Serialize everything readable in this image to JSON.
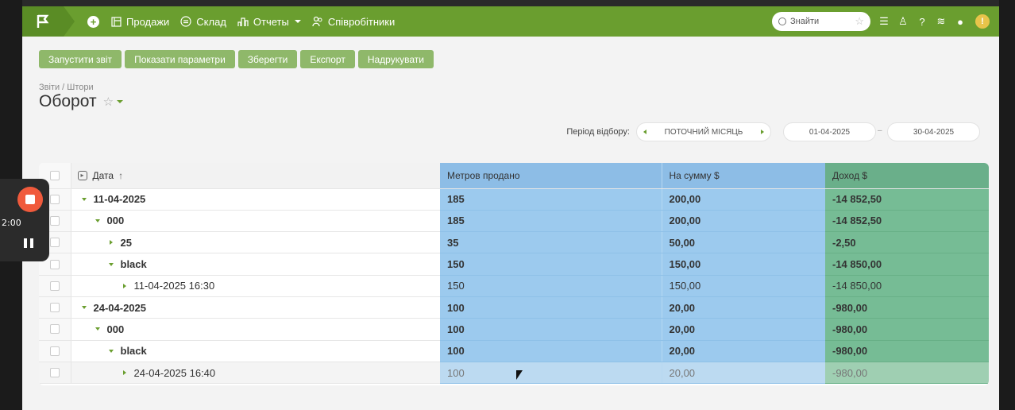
{
  "navbar": {
    "items": [
      {
        "label": "Продажи",
        "icon": "sales-icon"
      },
      {
        "label": "Склад",
        "icon": "warehouse-icon"
      },
      {
        "label": "Отчеты",
        "icon": "reports-icon"
      },
      {
        "label": "Співробітники",
        "icon": "employees-icon"
      }
    ],
    "search_placeholder": "Знайти",
    "avatar_initial": "!"
  },
  "toolbar": {
    "run": "Запустити звіт",
    "params": "Показати параметри",
    "save": "Зберегти",
    "export": "Експорт",
    "print": "Надрукувати"
  },
  "breadcrumb": "Звіти / Штори",
  "title": "Оборот",
  "period": {
    "label": "Період відбору:",
    "value": "ПОТОЧНИЙ МІСЯЦЬ",
    "from": "01-04-2025",
    "to": "30-04-2025",
    "separator": "–"
  },
  "table": {
    "headers": {
      "date": "Дата",
      "sort": "↑",
      "meters": "Метров продано",
      "sum": "На сумму $",
      "income": "Доход $"
    },
    "rows": [
      {
        "label": "11-04-2025",
        "meters": "185",
        "sum": "200,00",
        "income": "-14 852,50"
      },
      {
        "label": "000",
        "meters": "185",
        "sum": "200,00",
        "income": "-14 852,50"
      },
      {
        "label": "25",
        "meters": "35",
        "sum": "50,00",
        "income": "-2,50"
      },
      {
        "label": "black",
        "meters": "150",
        "sum": "150,00",
        "income": "-14 850,00"
      },
      {
        "label": "11-04-2025 16:30",
        "meters": "150",
        "sum": "150,00",
        "income": "-14 850,00"
      },
      {
        "label": "24-04-2025",
        "meters": "100",
        "sum": "20,00",
        "income": "-980,00"
      },
      {
        "label": "000",
        "meters": "100",
        "sum": "20,00",
        "income": "-980,00"
      },
      {
        "label": "black",
        "meters": "100",
        "sum": "20,00",
        "income": "-980,00"
      },
      {
        "label": "24-04-2025 16:40",
        "meters": "100",
        "sum": "20,00",
        "income": "-980,00"
      }
    ]
  },
  "recorder": {
    "time": "2:00"
  },
  "colors": {
    "brand": "#6a9e2f",
    "blue_cols": "#9ccaee",
    "green_col": "#76bc95"
  }
}
